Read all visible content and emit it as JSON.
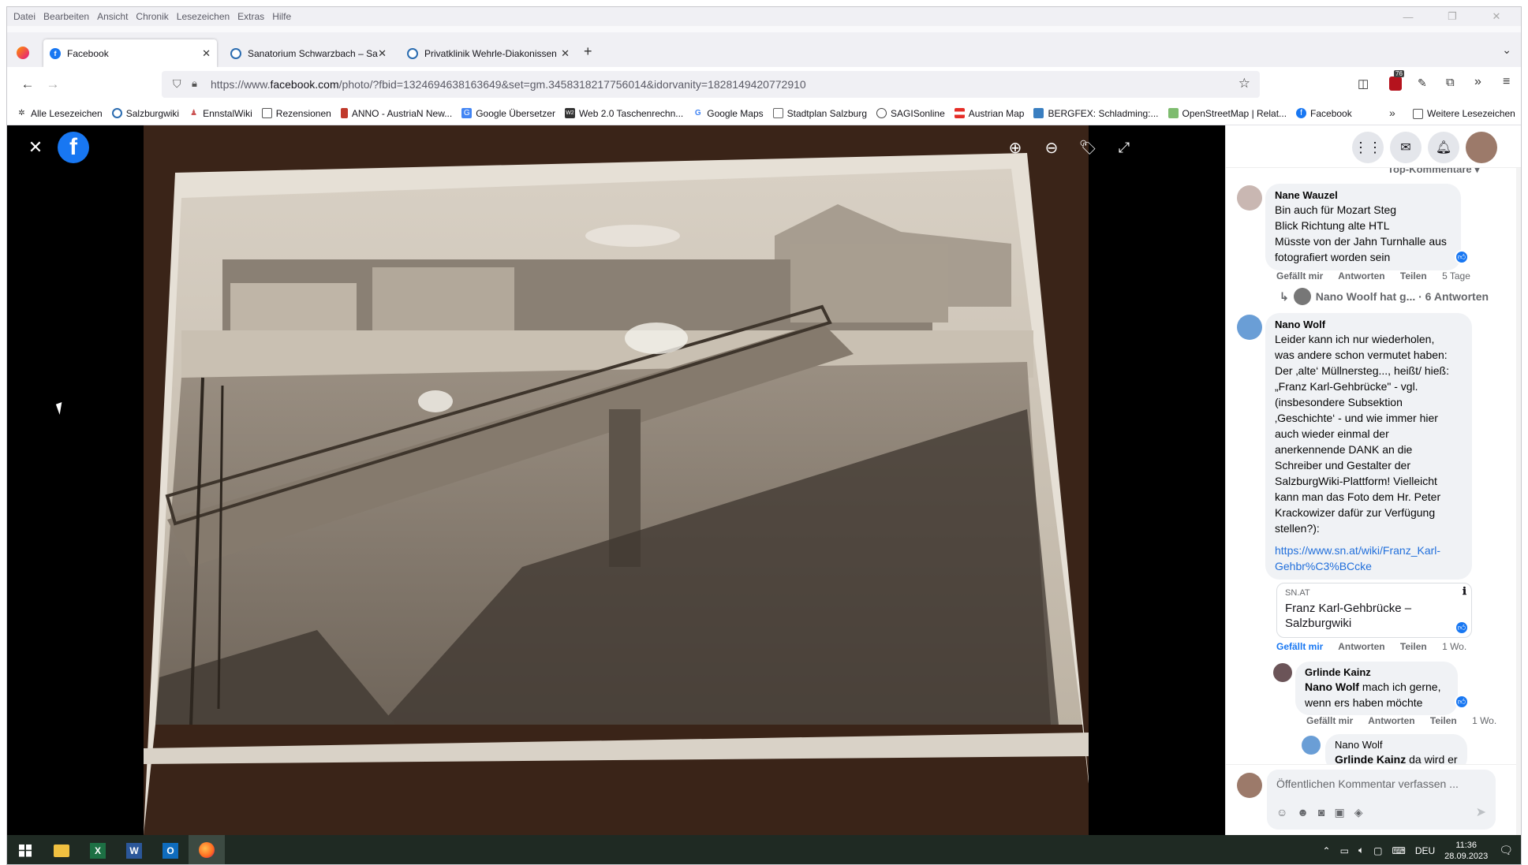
{
  "menu": [
    "Datei",
    "Bearbeiten",
    "Ansicht",
    "Chronik",
    "Lesezeichen",
    "Extras",
    "Hilfe"
  ],
  "tabs": [
    {
      "title": "Facebook",
      "active": true,
      "icon": "facebook-icon",
      "color": "#1877f2"
    },
    {
      "title": "Sanatorium Schwarzbach – Salz",
      "active": false,
      "icon": "salzburgwiki-icon",
      "color": "#2b6cb0"
    },
    {
      "title": "Privatklinik Wehrle-Diakonissen",
      "active": false,
      "icon": "salzburgwiki-icon",
      "color": "#2b6cb0"
    }
  ],
  "url": {
    "prefix": "https://www.",
    "domain": "facebook.com",
    "rest": "/photo/?fbid=1324694638163649&set=gm.3458318217756014&idorvanity=1828149420772910"
  },
  "extension_badge": "76",
  "bookmarks": [
    "Alle Lesezeichen",
    "Salzburgwiki",
    "EnnstalWiki",
    "Rezensionen",
    "ANNO - AustriaN New...",
    "Google Übersetzer",
    "Web 2.0 Taschenrechn...",
    "Google Maps",
    "Stadtplan Salzburg",
    "SAGISonline",
    "Austrian Map",
    "BERGFEX: Schladming:...",
    "OpenStreetMap | Relat...",
    "Facebook"
  ],
  "bookmarks_more": "Weitere Lesezeichen",
  "sidebar": {
    "top_comments_label": "Top-Kommentare",
    "comments": [
      {
        "name": "Nane Wauzel",
        "lines": [
          "Bin auch für Mozart Steg",
          "Blick Richtung alte HTL",
          "Müsste von der Jahn Turnhalle aus",
          "fotografiert worden sein"
        ],
        "like": "Gefällt mir",
        "reply": "Antworten",
        "share": "Teilen",
        "time": "5 Tage"
      },
      {
        "name": "Nano Wolf",
        "lines": [
          "Leider kann ich nur wiederholen,",
          "was andere schon vermutet haben:",
          "Der ‚alte‘ Müllnersteg..., heißt/ hieß:",
          "„Franz Karl-Gehbrücke\" - vgl.",
          "(insbesondere Subsektion",
          "‚Geschichte‘ - und wie immer hier",
          "auch wieder einmal der",
          "anerkennende DANK an die",
          "Schreiber und Gestalter der",
          "SalzburgWiki-Plattform! Vielleicht",
          "kann man das Foto dem Hr. Peter",
          "Krackowizer dafür zur Verfügung",
          "stellen?):"
        ],
        "link": [
          "https://www.sn.at/wiki/Franz_Karl-",
          "Gehbr%C3%BCcke"
        ],
        "like": "Gefällt mir",
        "reply": "Antworten",
        "share": "Teilen",
        "time": "1 Wo."
      },
      {
        "name": "Grlinde Kainz",
        "mention": "Nano Wolf",
        "text1": " mach ich gerne,",
        "text2": "wenn ers haben möchte",
        "like": "Gefällt mir",
        "reply": "Antworten",
        "share": "Teilen",
        "time": "1 Wo."
      },
      {
        "name": "Nano Wolf",
        "mention": "Grlinde Kainz",
        "text1": " da wird er"
      }
    ],
    "replies_summary": "Nano Woolf hat g... · 6 Antworten",
    "link_preview": {
      "source": "SN.AT",
      "title1": "Franz Karl-Gehbrücke –",
      "title2": "Salzburgwiki"
    },
    "composer_placeholder": "Öffentlichen Kommentar verfassen ..."
  },
  "taskbar": {
    "lang": "DEU",
    "time": "11:36",
    "date": "28.09.2023"
  }
}
